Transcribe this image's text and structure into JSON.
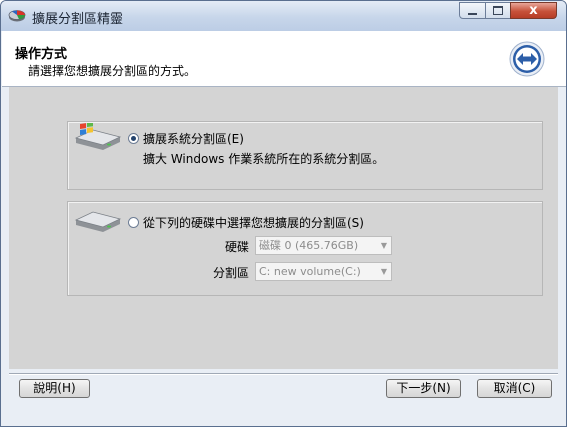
{
  "window": {
    "title": "擴展分割區精靈",
    "controls": {
      "minimize_icon": "minimize-icon",
      "maximize_icon": "maximize-icon",
      "close_glyph": "x"
    }
  },
  "header": {
    "title": "操作方式",
    "subtitle": "請選擇您想擴展分割區的方式。",
    "icon": "expand-arrows-icon"
  },
  "options": [
    {
      "label": "擴展系統分割區(E)",
      "description": "擴大 Windows 作業系統所在的系統分割區。",
      "selected": true,
      "icon": "windows-system-disk-icon"
    },
    {
      "label": "從下列的硬碟中選擇您想擴展的分割區(S)",
      "selected": false,
      "icon": "hard-disk-icon",
      "fields": [
        {
          "label": "硬碟",
          "value": "磁碟 0 (465.76GB)"
        },
        {
          "label": "分割區",
          "value": "C: new volume(C:)"
        }
      ]
    }
  ],
  "buttons": {
    "help": "說明(H)",
    "next": "下一步(N)",
    "cancel": "取消(C)"
  },
  "colors": {
    "accent": "#2c5ea8",
    "disabled_text": "#8c8c8c",
    "panel": "#d4d4d4"
  }
}
